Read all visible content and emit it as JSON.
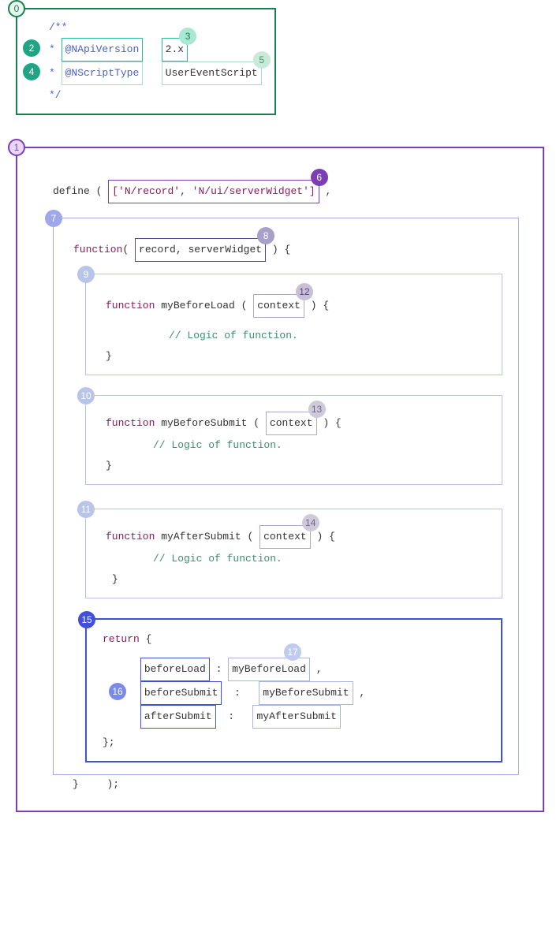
{
  "jsdoc": {
    "open": "/**",
    "apiVersionTag": "@NApiVersion",
    "apiVersionVal": "2.x",
    "scriptTypeTag": "@NScriptType",
    "scriptTypeVal": "UserEventScript",
    "close": "*/"
  },
  "define": {
    "keyword": "define",
    "modules": "['N/record', 'N/ui/serverWidget']"
  },
  "callback": {
    "fnKeyword": "function",
    "params": "record, serverWidget",
    "commentLogic": "// Logic of function.",
    "beforeLoad": {
      "name": "myBeforeLoad",
      "arg": "context"
    },
    "beforeSubmit": {
      "name": "myBeforeSubmit",
      "arg": "context"
    },
    "afterSubmit": {
      "name": "myAfterSubmit",
      "arg": "context"
    }
  },
  "ret": {
    "keyword": "return",
    "pairs": {
      "k1": "beforeLoad",
      "v1": "myBeforeLoad",
      "k2": "beforeSubmit",
      "v2": "myBeforeSubmit",
      "k3": "afterSubmit",
      "v3": "myAfterSubmit"
    }
  },
  "labels": {
    "n0": "0",
    "n1": "1",
    "n2": "2",
    "n3": "3",
    "n4": "4",
    "n5": "5",
    "n6": "6",
    "n7": "7",
    "n8": "8",
    "n9": "9",
    "n10": "10",
    "n11": "11",
    "n12": "12",
    "n13": "13",
    "n14": "14",
    "n15": "15",
    "n16": "16",
    "n17": "17"
  },
  "colors": {
    "darkGreen": "#1a7f4f",
    "teal": "#2bb9a0",
    "lightGreen": "#a8dcc5",
    "purple": "#7b3fb3",
    "lavender": "#9fa8e8",
    "darkPurple": "#5a4a8a",
    "grayPurple": "#b0a8c8",
    "lightBlue": "#b8c5e8",
    "blue": "#4050d8",
    "blueLight": "#7a8ae8"
  },
  "syntax": {
    "star": "*",
    "openBrace": "{",
    "closeBrace": "}",
    "openParen": "(",
    "closeParen": ")",
    "colon": ":",
    "comma": ",",
    "semicolon": ";",
    "closeBraceSemi": "};",
    "closeParenSemi": ");"
  }
}
